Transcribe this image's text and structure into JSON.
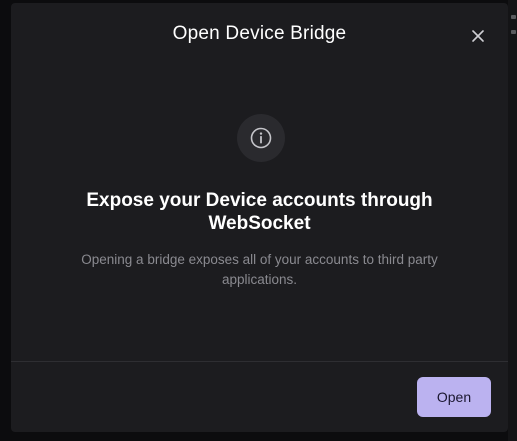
{
  "modal": {
    "title": "Open Device Bridge",
    "close_icon": "close-icon",
    "info_icon": "info-icon",
    "headline": "Expose your Device accounts through WebSocket",
    "description": "Opening a bridge exposes all of your accounts to third party applications.",
    "open_button_label": "Open"
  },
  "colors": {
    "modal_background": "#1c1c1f",
    "backdrop": "#0c0c0e",
    "accent_button": "#bbb2f0",
    "title_text": "#ffffff",
    "muted_text": "#8a8a90"
  }
}
